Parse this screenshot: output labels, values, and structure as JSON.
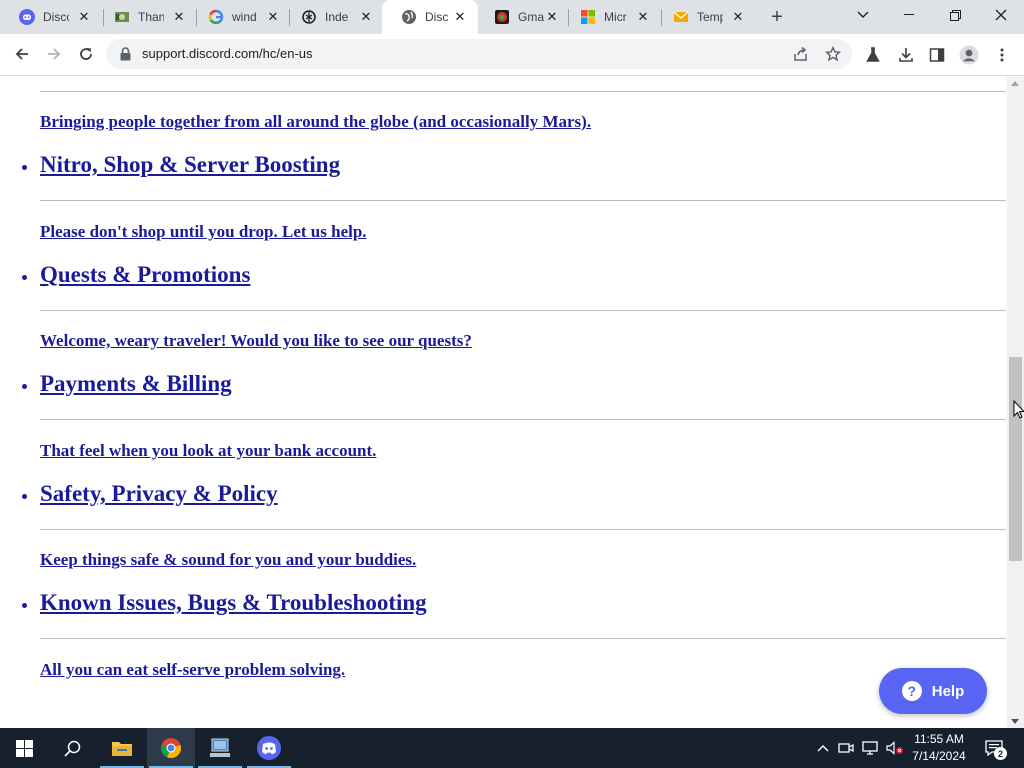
{
  "browser": {
    "tabs": [
      {
        "title": "Disco",
        "icon": "discord-icon"
      },
      {
        "title": "Than",
        "icon": "money-icon"
      },
      {
        "title": "wind",
        "icon": "google-icon"
      },
      {
        "title": "Inde",
        "icon": "chatgpt-icon"
      },
      {
        "title": "Disc",
        "icon": "globe-icon",
        "active": true
      },
      {
        "title": "Gma",
        "icon": "gmail-icon"
      },
      {
        "title": "Micr",
        "icon": "microsoft-icon"
      },
      {
        "title": "Temp",
        "icon": "mail-icon"
      }
    ],
    "url": "support.discord.com/hc/en-us"
  },
  "page": {
    "top_description": "Bringing people together from all around the globe (and occasionally Mars).",
    "categories": [
      {
        "title": "Nitro, Shop & Server Boosting",
        "description": "Please don't shop until you drop. Let us help."
      },
      {
        "title": "Quests & Promotions",
        "description": "Welcome, weary traveler! Would you like to see our quests?"
      },
      {
        "title": "Payments & Billing",
        "description": "That feel when you look at your bank account."
      },
      {
        "title": "Safety, Privacy & Policy",
        "description": "Keep things safe & sound for you and your buddies."
      },
      {
        "title": "Known Issues, Bugs & Troubleshooting",
        "description": "All you can eat self-serve problem solving."
      }
    ],
    "help_label": "Help"
  },
  "taskbar": {
    "time": "11:55 AM",
    "date": "7/14/2024",
    "notification_count": "2"
  },
  "colors": {
    "link": "#1b1b9a",
    "help_button": "#5865f2",
    "taskbar": "#17212e"
  }
}
